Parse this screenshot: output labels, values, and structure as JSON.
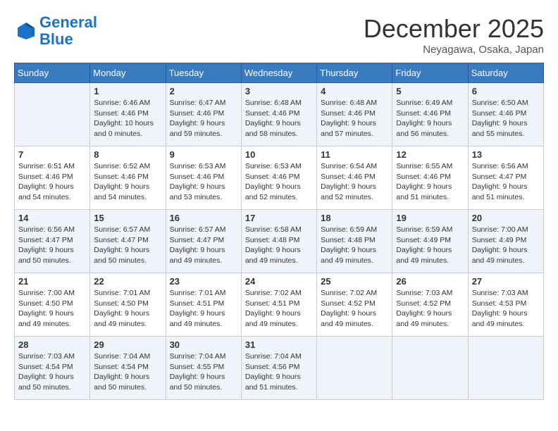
{
  "logo": {
    "line1": "General",
    "line2": "Blue"
  },
  "title": "December 2025",
  "location": "Neyagawa, Osaka, Japan",
  "days_of_week": [
    "Sunday",
    "Monday",
    "Tuesday",
    "Wednesday",
    "Thursday",
    "Friday",
    "Saturday"
  ],
  "weeks": [
    [
      {
        "day": "",
        "info": ""
      },
      {
        "day": "1",
        "info": "Sunrise: 6:46 AM\nSunset: 4:46 PM\nDaylight: 10 hours\nand 0 minutes."
      },
      {
        "day": "2",
        "info": "Sunrise: 6:47 AM\nSunset: 4:46 PM\nDaylight: 9 hours\nand 59 minutes."
      },
      {
        "day": "3",
        "info": "Sunrise: 6:48 AM\nSunset: 4:46 PM\nDaylight: 9 hours\nand 58 minutes."
      },
      {
        "day": "4",
        "info": "Sunrise: 6:48 AM\nSunset: 4:46 PM\nDaylight: 9 hours\nand 57 minutes."
      },
      {
        "day": "5",
        "info": "Sunrise: 6:49 AM\nSunset: 4:46 PM\nDaylight: 9 hours\nand 56 minutes."
      },
      {
        "day": "6",
        "info": "Sunrise: 6:50 AM\nSunset: 4:46 PM\nDaylight: 9 hours\nand 55 minutes."
      }
    ],
    [
      {
        "day": "7",
        "info": "Sunrise: 6:51 AM\nSunset: 4:46 PM\nDaylight: 9 hours\nand 54 minutes."
      },
      {
        "day": "8",
        "info": "Sunrise: 6:52 AM\nSunset: 4:46 PM\nDaylight: 9 hours\nand 54 minutes."
      },
      {
        "day": "9",
        "info": "Sunrise: 6:53 AM\nSunset: 4:46 PM\nDaylight: 9 hours\nand 53 minutes."
      },
      {
        "day": "10",
        "info": "Sunrise: 6:53 AM\nSunset: 4:46 PM\nDaylight: 9 hours\nand 52 minutes."
      },
      {
        "day": "11",
        "info": "Sunrise: 6:54 AM\nSunset: 4:46 PM\nDaylight: 9 hours\nand 52 minutes."
      },
      {
        "day": "12",
        "info": "Sunrise: 6:55 AM\nSunset: 4:46 PM\nDaylight: 9 hours\nand 51 minutes."
      },
      {
        "day": "13",
        "info": "Sunrise: 6:56 AM\nSunset: 4:47 PM\nDaylight: 9 hours\nand 51 minutes."
      }
    ],
    [
      {
        "day": "14",
        "info": "Sunrise: 6:56 AM\nSunset: 4:47 PM\nDaylight: 9 hours\nand 50 minutes."
      },
      {
        "day": "15",
        "info": "Sunrise: 6:57 AM\nSunset: 4:47 PM\nDaylight: 9 hours\nand 50 minutes."
      },
      {
        "day": "16",
        "info": "Sunrise: 6:57 AM\nSunset: 4:47 PM\nDaylight: 9 hours\nand 49 minutes."
      },
      {
        "day": "17",
        "info": "Sunrise: 6:58 AM\nSunset: 4:48 PM\nDaylight: 9 hours\nand 49 minutes."
      },
      {
        "day": "18",
        "info": "Sunrise: 6:59 AM\nSunset: 4:48 PM\nDaylight: 9 hours\nand 49 minutes."
      },
      {
        "day": "19",
        "info": "Sunrise: 6:59 AM\nSunset: 4:49 PM\nDaylight: 9 hours\nand 49 minutes."
      },
      {
        "day": "20",
        "info": "Sunrise: 7:00 AM\nSunset: 4:49 PM\nDaylight: 9 hours\nand 49 minutes."
      }
    ],
    [
      {
        "day": "21",
        "info": "Sunrise: 7:00 AM\nSunset: 4:50 PM\nDaylight: 9 hours\nand 49 minutes."
      },
      {
        "day": "22",
        "info": "Sunrise: 7:01 AM\nSunset: 4:50 PM\nDaylight: 9 hours\nand 49 minutes."
      },
      {
        "day": "23",
        "info": "Sunrise: 7:01 AM\nSunset: 4:51 PM\nDaylight: 9 hours\nand 49 minutes."
      },
      {
        "day": "24",
        "info": "Sunrise: 7:02 AM\nSunset: 4:51 PM\nDaylight: 9 hours\nand 49 minutes."
      },
      {
        "day": "25",
        "info": "Sunrise: 7:02 AM\nSunset: 4:52 PM\nDaylight: 9 hours\nand 49 minutes."
      },
      {
        "day": "26",
        "info": "Sunrise: 7:03 AM\nSunset: 4:52 PM\nDaylight: 9 hours\nand 49 minutes."
      },
      {
        "day": "27",
        "info": "Sunrise: 7:03 AM\nSunset: 4:53 PM\nDaylight: 9 hours\nand 49 minutes."
      }
    ],
    [
      {
        "day": "28",
        "info": "Sunrise: 7:03 AM\nSunset: 4:54 PM\nDaylight: 9 hours\nand 50 minutes."
      },
      {
        "day": "29",
        "info": "Sunrise: 7:04 AM\nSunset: 4:54 PM\nDaylight: 9 hours\nand 50 minutes."
      },
      {
        "day": "30",
        "info": "Sunrise: 7:04 AM\nSunset: 4:55 PM\nDaylight: 9 hours\nand 50 minutes."
      },
      {
        "day": "31",
        "info": "Sunrise: 7:04 AM\nSunset: 4:56 PM\nDaylight: 9 hours\nand 51 minutes."
      },
      {
        "day": "",
        "info": ""
      },
      {
        "day": "",
        "info": ""
      },
      {
        "day": "",
        "info": ""
      }
    ]
  ]
}
